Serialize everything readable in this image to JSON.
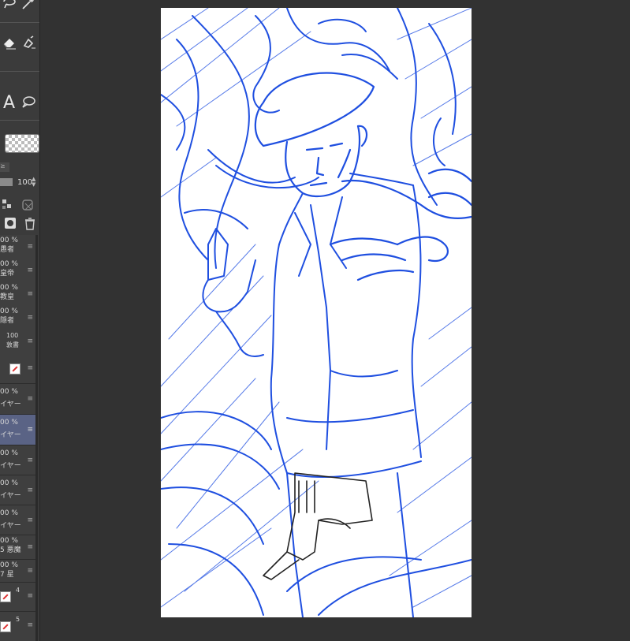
{
  "toolbar": {
    "tools": [
      {
        "name": "lasso-icon"
      },
      {
        "name": "magic-wand-icon"
      },
      {
        "name": "eraser-icon"
      },
      {
        "name": "fill-bucket-icon"
      },
      {
        "name": "text-tool-icon",
        "label": "A"
      },
      {
        "name": "balloon-icon"
      }
    ],
    "opacity_value": "100"
  },
  "layers": [
    {
      "pct": "00 %",
      "name": "愚者"
    },
    {
      "pct": "00 %",
      "name": "皇帝"
    },
    {
      "pct": "00 %",
      "name": "教皇"
    },
    {
      "pct": "00 %",
      "name": "隠者"
    },
    {
      "pct": "100",
      "name": "敦書"
    },
    {
      "pct": "",
      "name": ""
    },
    {
      "pct": "00 %",
      "name": "イヤー"
    },
    {
      "pct": "00 %",
      "name": "イヤー",
      "selected": true
    },
    {
      "pct": "00 %",
      "name": "イヤー"
    },
    {
      "pct": "00 %",
      "name": "イヤー"
    },
    {
      "pct": "00 %",
      "name": "イヤー"
    },
    {
      "pct": "00 %",
      "name": "5 悪魔"
    },
    {
      "pct": "00 %",
      "name": "7 星"
    },
    {
      "pct": "",
      "name": "4"
    },
    {
      "pct": "",
      "name": "5"
    }
  ],
  "colors": {
    "panel_bg": "#3b3b3b",
    "app_bg": "#323232",
    "selected_layer": "#5a6385",
    "sketch_blue": "#1f4fe0"
  }
}
